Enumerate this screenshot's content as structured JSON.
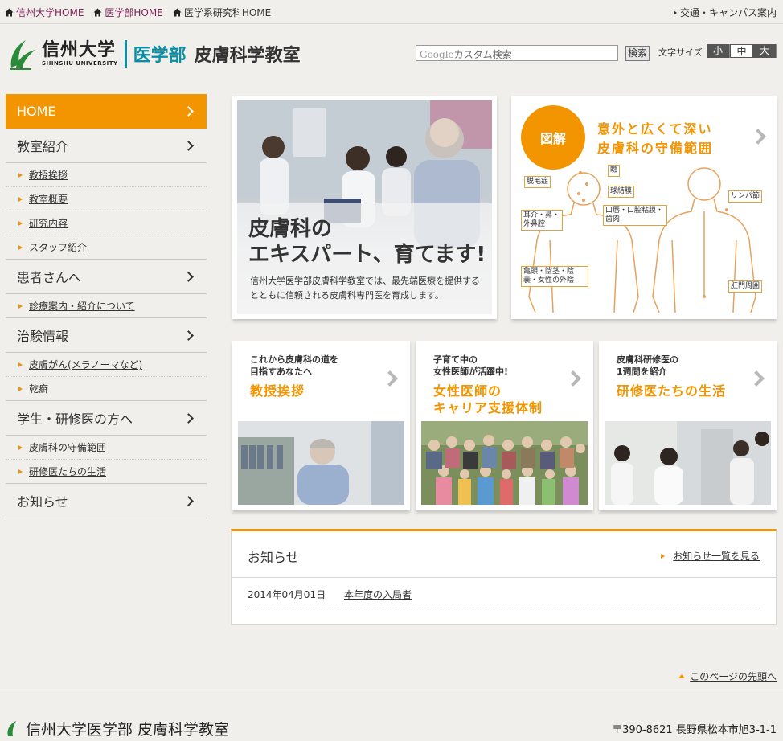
{
  "topbar": {
    "links": [
      "信州大学HOME",
      "医学部HOME",
      "医学系研究科HOME"
    ],
    "access": "交通・キャンパス案内"
  },
  "header": {
    "university_jp": "信州大学",
    "university_en": "SHINSHU UNIVERSITY",
    "faculty": "医学部",
    "department": "皮膚科学教室",
    "search_placeholder": "カスタム検索",
    "search_brand": "Google",
    "search_button": "検索",
    "font_size_label": "文字サイズ",
    "font_sizes": [
      "小",
      "中",
      "大"
    ],
    "font_size_selected": "中"
  },
  "sidebar": {
    "home": "HOME",
    "sections": [
      {
        "label": "教室紹介",
        "items": [
          "教授挨拶",
          "教室概要",
          "研究内容",
          "スタッフ紹介"
        ]
      },
      {
        "label": "患者さんへ",
        "items": [
          "診療案内・紹介について"
        ]
      },
      {
        "label": "治験情報",
        "items": [
          "皮膚がん(メラノーマなど)",
          "乾癬"
        ]
      },
      {
        "label": "学生・研修医の方へ",
        "items": [
          "皮膚科の守備範囲",
          "研修医たちの生活"
        ]
      },
      {
        "label": "お知らせ",
        "items": []
      }
    ]
  },
  "hero": {
    "headline_1": "皮膚科の",
    "headline_2": "エキスパート、育てます!",
    "desc": "信州大学医学部皮膚科学教室では、最先端医療を提供するとともに信頼される皮膚科専門医を育成します。"
  },
  "zukai": {
    "badge": "図解",
    "title_1": "意外と広くて深い",
    "title_2": "皮膚科の守備範囲",
    "tags": [
      "脱毛症",
      "瞼",
      "球結膜",
      "耳介・鼻・外鼻腔",
      "口唇・口腔粘膜・歯肉",
      "リンパ節",
      "亀頭・陰茎・陰嚢・女性の外陰",
      "肛門周囲"
    ]
  },
  "cards": [
    {
      "sub_1": "これから皮膚科の道を",
      "sub_2": "目指すあなたへ",
      "title_1": "教授挨拶",
      "title_2": ""
    },
    {
      "sub_1": "子育て中の",
      "sub_2": "女性医師が活躍中!",
      "title_1": "女性医師の",
      "title_2": "キャリア支援体制"
    },
    {
      "sub_1": "皮膚科研修医の",
      "sub_2": "1週間を紹介",
      "title_1": "研修医たちの生活",
      "title_2": ""
    }
  ],
  "news": {
    "title": "お知らせ",
    "more": "お知らせ一覧を見る",
    "items": [
      {
        "date": "2014年04月01日",
        "text": "本年度の入局者"
      }
    ]
  },
  "pagetop": "このページの先頭へ",
  "footer": {
    "name": "信州大学医学部 皮膚科学教室",
    "address": "〒390-8621 長野県松本市旭3-1-1"
  },
  "colors": {
    "accent": "#f29500",
    "faculty": "#0a8fa8",
    "link": "#7a1f52"
  }
}
